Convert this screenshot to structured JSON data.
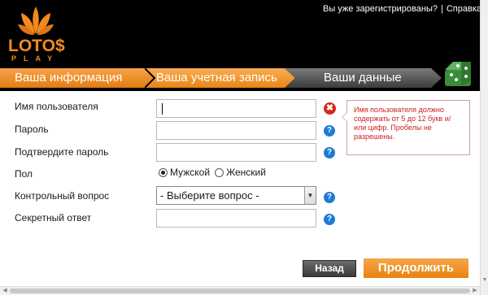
{
  "brand": {
    "name": "LOTO$",
    "sub": "PLAY",
    "accent": "#f08a1c"
  },
  "top_links": {
    "registered": "Вы уже зарегистрированы?",
    "separator": "|",
    "help": "Справка"
  },
  "steps": [
    {
      "label": "Ваша информация",
      "state": "done"
    },
    {
      "label": "Ваша учетная запись",
      "state": "active"
    },
    {
      "label": "Ваши данные",
      "state": "pending"
    }
  ],
  "form": {
    "username_label": "Имя пользователя",
    "username_value": "",
    "password_label": "Пароль",
    "password_value": "",
    "confirm_label": "Подтвердите пароль",
    "confirm_value": "",
    "gender_label": "Пол",
    "gender_options": [
      "Мужской",
      "Женский"
    ],
    "gender_selected": "Мужской",
    "question_label": "Контрольный вопрос",
    "question_value": "- Выберите вопрос -",
    "answer_label": "Секретный ответ",
    "answer_value": ""
  },
  "error_tooltip": {
    "text": "Имя пользователя должно содержать от 5 до 12 букв и/или цифр. Пробелы не разрешены.",
    "color": "#cc1e1e"
  },
  "icons": {
    "help": "?",
    "error": "✖"
  },
  "buttons": {
    "back": "Назад",
    "next": "Продолжить"
  },
  "colors": {
    "step_orange": "#f08a1c",
    "step_gray": "#5a5a5a",
    "help_blue": "#1f7bd4",
    "error_red": "#d9231c"
  }
}
